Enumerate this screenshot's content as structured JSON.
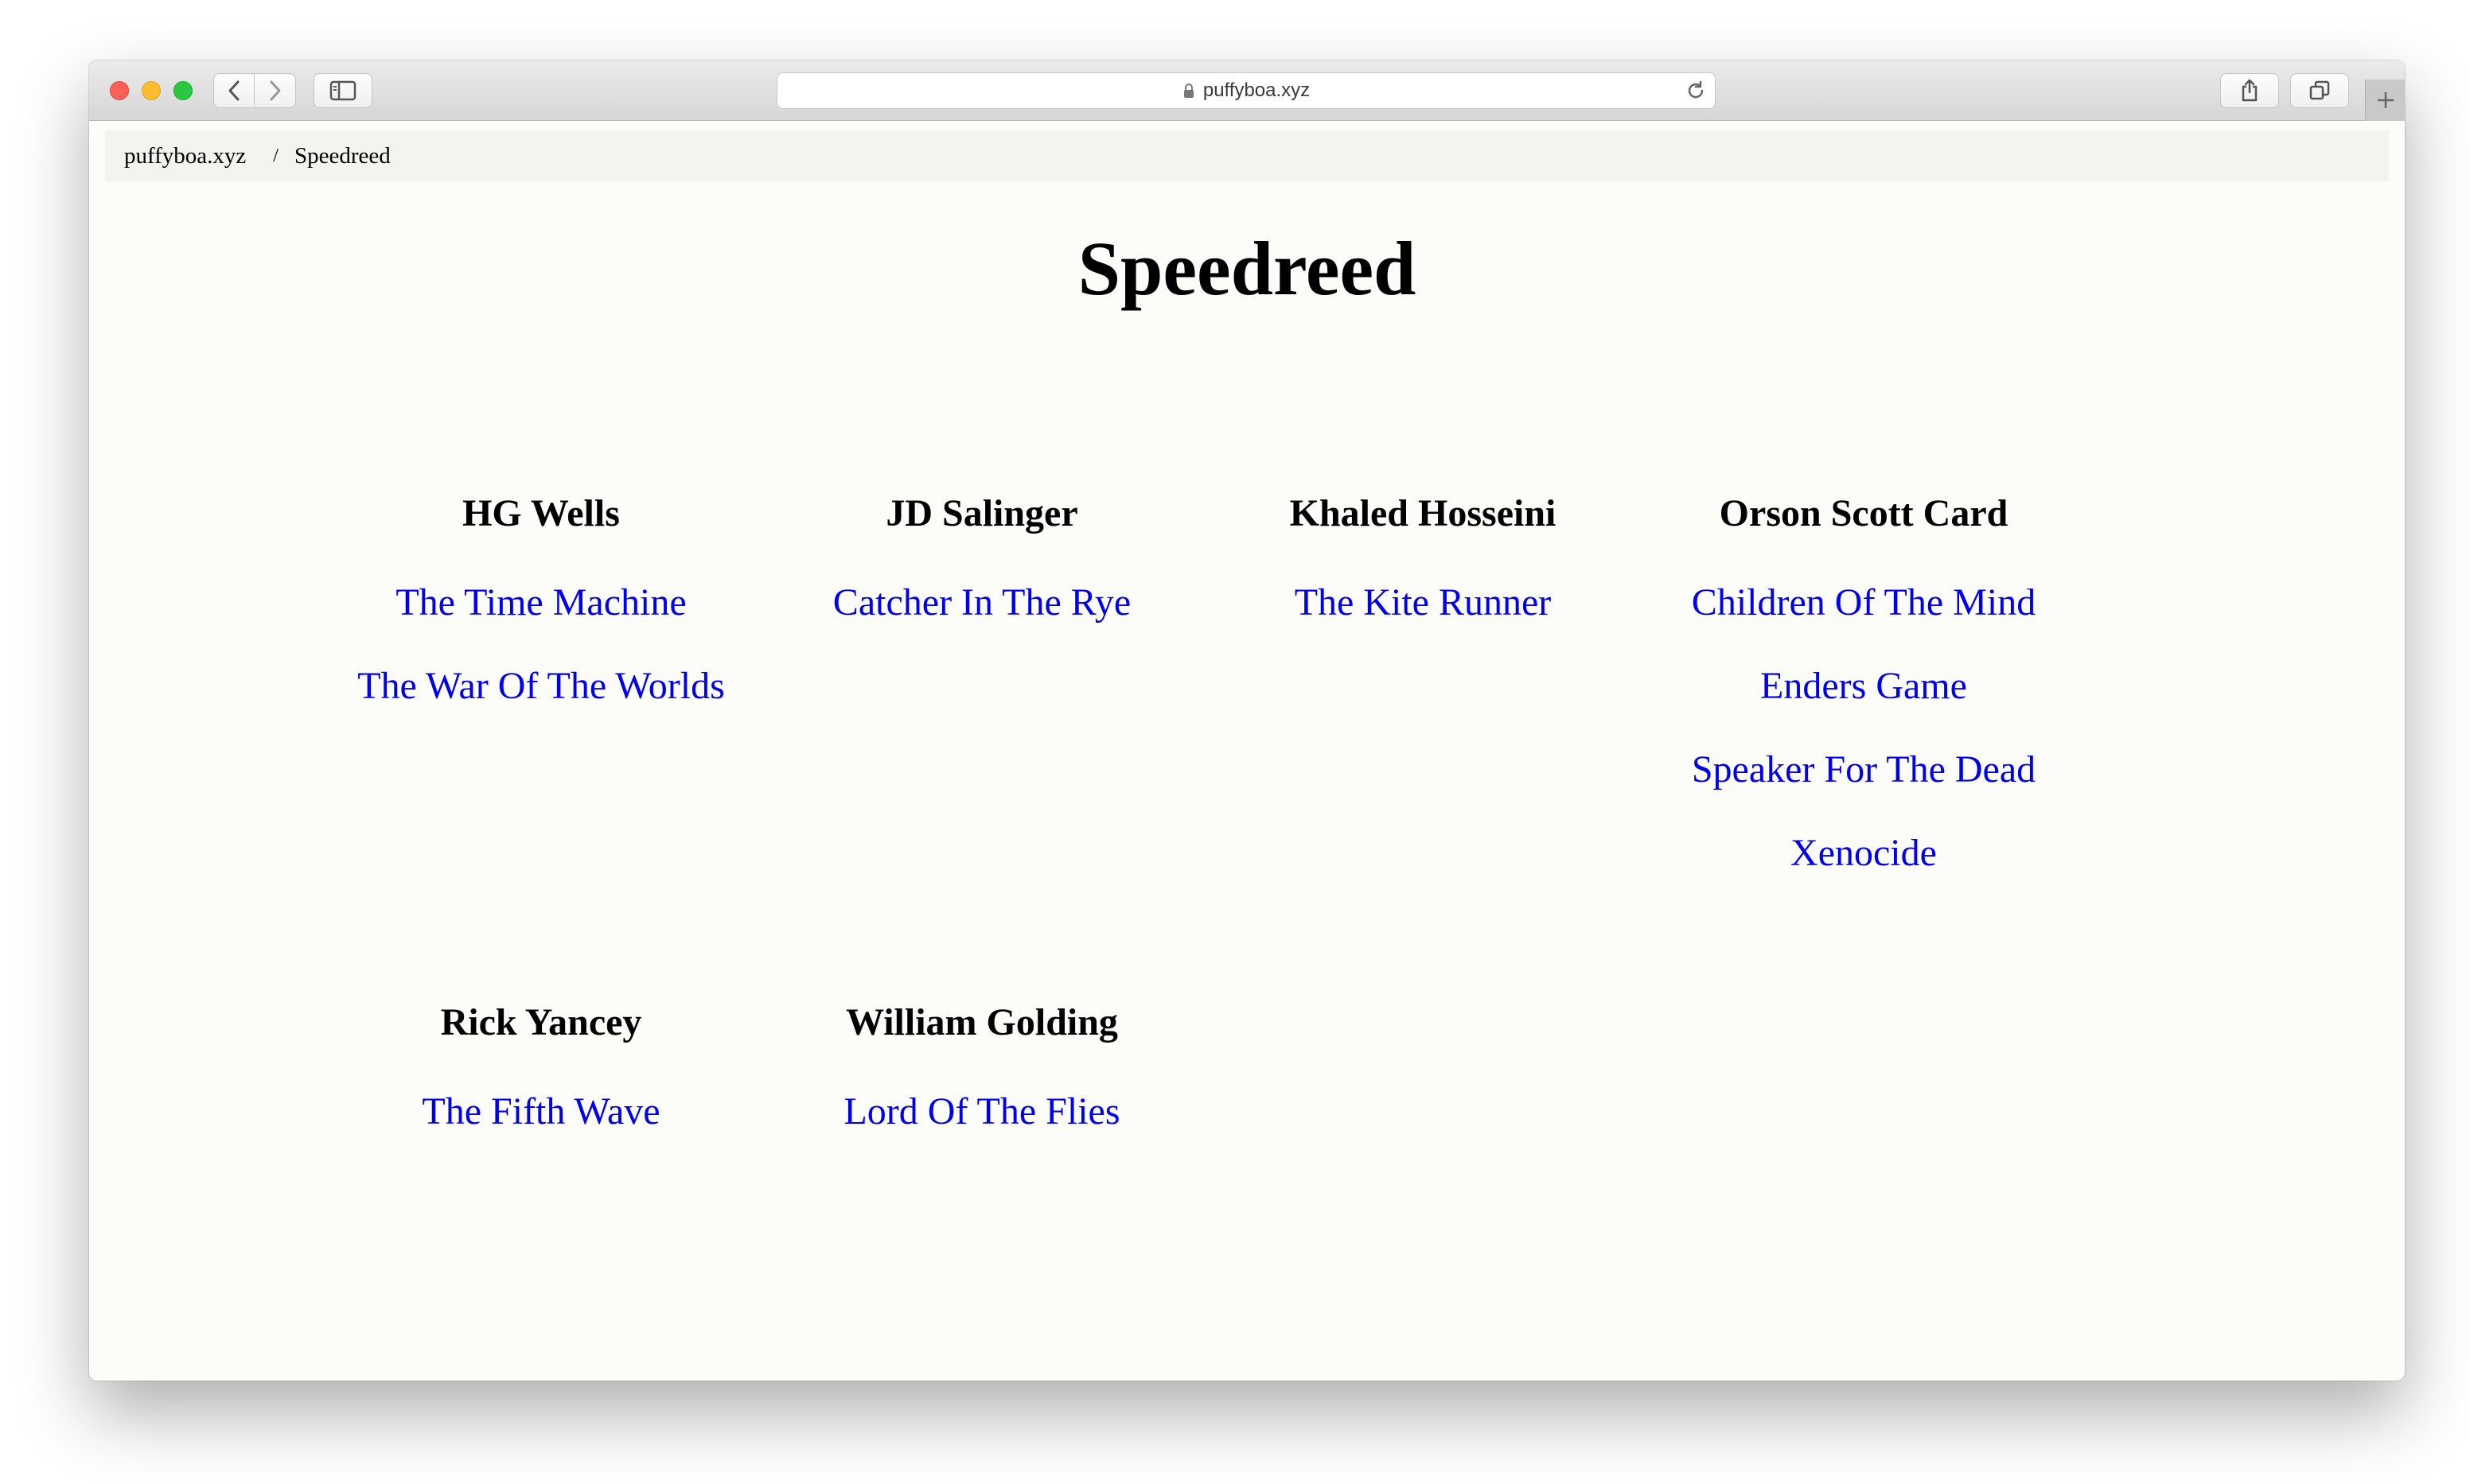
{
  "browser": {
    "url": "puffyboa.xyz"
  },
  "breadcrumb": {
    "home": "puffyboa.xyz",
    "separator": "/",
    "current": "Speedreed"
  },
  "page": {
    "title": "Speedreed"
  },
  "authors": [
    {
      "name": "HG Wells",
      "books": [
        "The Time Machine",
        "The War Of The Worlds"
      ]
    },
    {
      "name": "JD Salinger",
      "books": [
        "Catcher In The Rye"
      ]
    },
    {
      "name": "Khaled Hosseini",
      "books": [
        "The Kite Runner"
      ]
    },
    {
      "name": "Orson Scott Card",
      "books": [
        "Children Of The Mind",
        "Enders Game",
        "Speaker For The Dead",
        "Xenocide"
      ]
    },
    {
      "name": "Rick Yancey",
      "books": [
        "The Fifth Wave"
      ]
    },
    {
      "name": "William Golding",
      "books": [
        "Lord Of The Flies"
      ]
    }
  ],
  "colors": {
    "link": "#0000ee",
    "page_background": "#fcfdf8",
    "breadcrumb_background": "#f3f4ef"
  }
}
